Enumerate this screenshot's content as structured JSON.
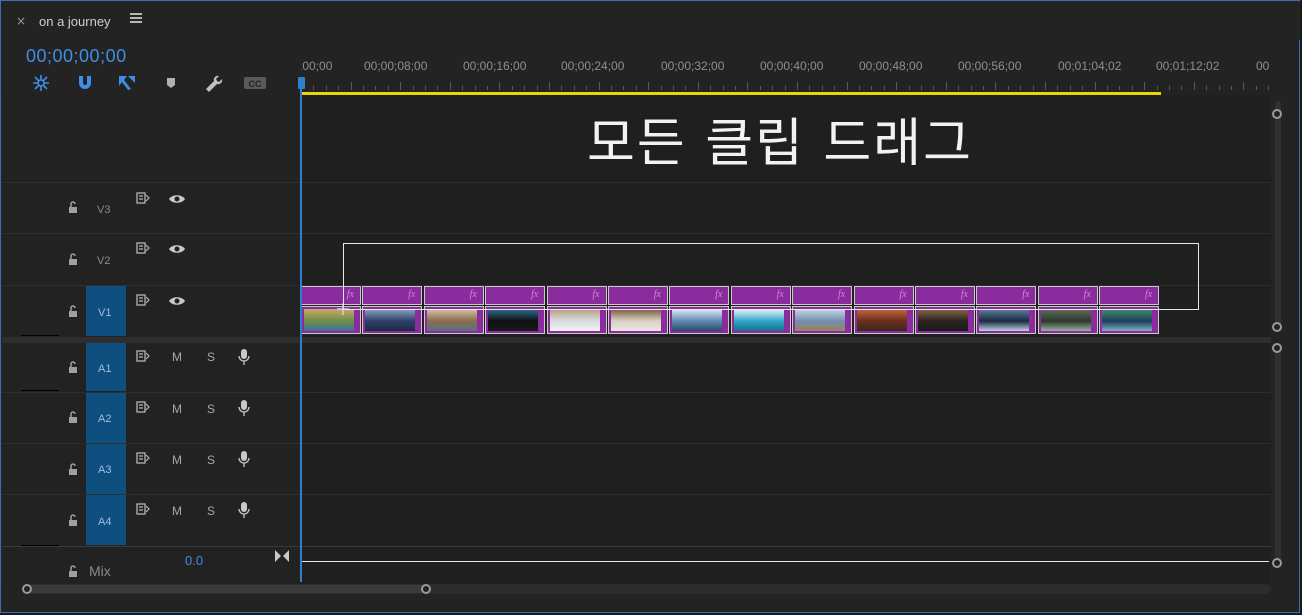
{
  "tab": {
    "close": "×",
    "title": "on a journey"
  },
  "timecode": "00;00;00;00",
  "ruler": {
    "labels": [
      ";00;00",
      "00;00;08;00",
      "00;00;16;00",
      "00;00;24;00",
      "00;00;32;00",
      "00;00;40;00",
      "00;00;48;00",
      "00;00;56;00",
      "00;01;04;02",
      "00;01;12;02",
      "00"
    ]
  },
  "overlay_text": "모든 클립 드래그",
  "tracks": {
    "video": [
      {
        "name": "V3"
      },
      {
        "name": "V2"
      },
      {
        "name": "V1"
      }
    ],
    "audio": [
      {
        "name": "A1",
        "m": "M",
        "s": "S"
      },
      {
        "name": "A2",
        "m": "M",
        "s": "S"
      },
      {
        "name": "A3",
        "m": "M",
        "s": "S"
      },
      {
        "name": "A4",
        "m": "M",
        "s": "S"
      }
    ]
  },
  "mix": {
    "label": "Mix",
    "value": "0.0"
  },
  "clips": {
    "fx_label": "fx",
    "count": 14
  },
  "colors": {
    "accent": "#3d8ee5",
    "clip": "#8a2c9e",
    "workbar": "#e8d60a",
    "track_selected": "#0f4f80"
  }
}
